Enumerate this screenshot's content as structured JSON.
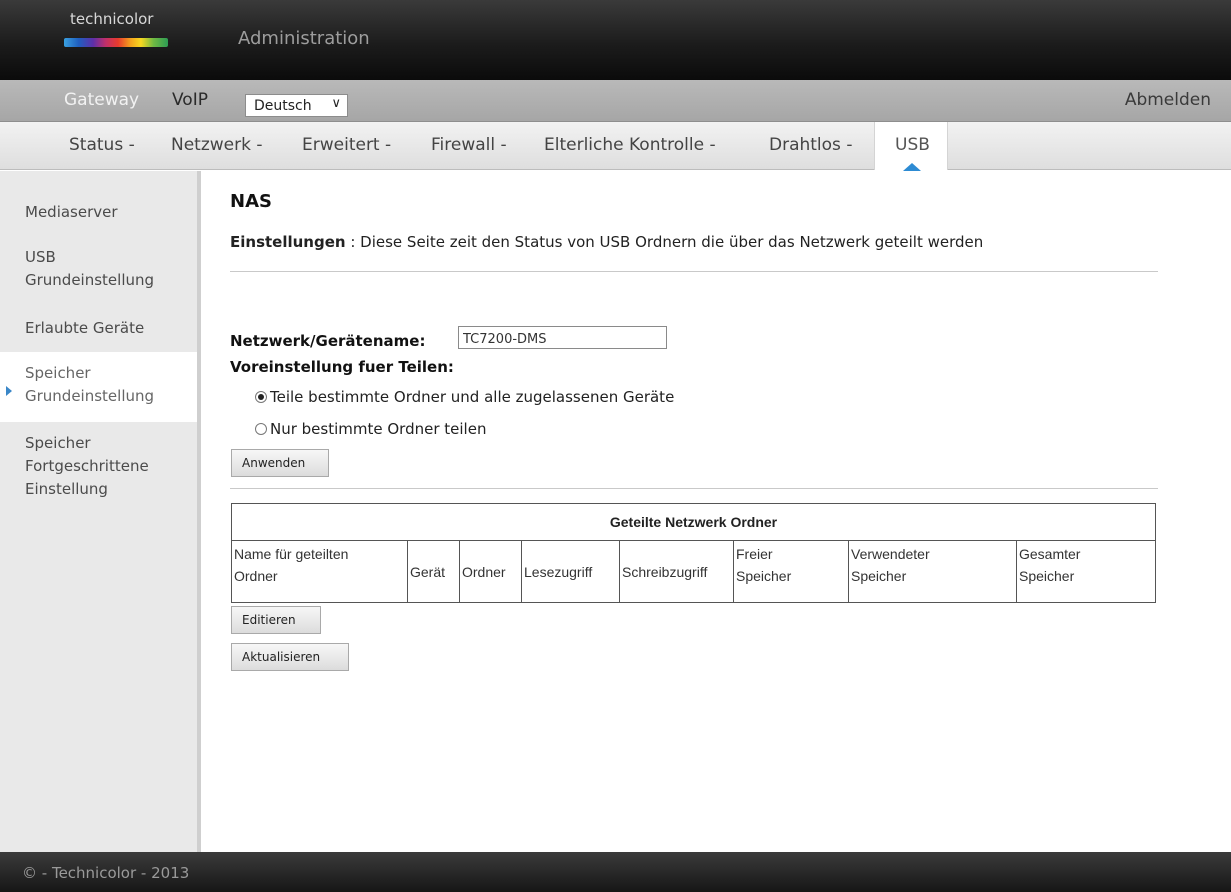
{
  "header": {
    "brand": "technicolor",
    "title": "Administration"
  },
  "nav_primary": {
    "gateway": "Gateway",
    "voip": "VoIP",
    "language_selected": "Deutsch",
    "logout": "Abmelden"
  },
  "nav_secondary": {
    "items": [
      "Status -",
      "Netzwerk -",
      "Erweitert -",
      "Firewall -",
      "Elterliche Kontrolle -",
      "Drahtlos -"
    ],
    "active": "USB"
  },
  "sidebar": {
    "items": [
      {
        "label": "Mediaserver"
      },
      {
        "label": "USB Grundeinstellung",
        "line1": "USB",
        "line2": "Grundeinstellung"
      },
      {
        "label": "Erlaubte Geräte"
      },
      {
        "label": "Speicher Grundeinstellung",
        "line1": "Speicher",
        "line2": "Grundeinstellung",
        "active": true
      },
      {
        "label": "Speicher Fortgeschrittene Einstellung",
        "line1": "Speicher",
        "line2": "Fortgeschrittene",
        "line3": "Einstellung"
      }
    ]
  },
  "main": {
    "heading": "NAS",
    "settings_label": "Einstellungen",
    "settings_text": " : Diese Seite zeit den Status von USB Ordnern die über das Netzwerk geteilt werden",
    "netname_label": "Netzwerk/Gerätename:",
    "netname_value": "TC7200-DMS",
    "share_default_label": "Voreinstellung fuer Teilen:",
    "radio_options": [
      {
        "label": "Teile bestimmte Ordner und alle zugelassenen Geräte",
        "checked": true
      },
      {
        "label": "Nur bestimmte Ordner teilen",
        "checked": false
      }
    ],
    "apply_button": "Anwenden",
    "table": {
      "caption": "Geteilte Netzwerk Ordner",
      "columns": [
        {
          "line1": "Name für geteilten",
          "line2": "Ordner"
        },
        {
          "line1": "Gerät"
        },
        {
          "line1": "Ordner"
        },
        {
          "line1": "Lesezugriff"
        },
        {
          "line1": "Schreibzugriff"
        },
        {
          "line1": "Freier",
          "line2": "Speicher"
        },
        {
          "line1": "Verwendeter",
          "line2": "Speicher"
        },
        {
          "line1": "Gesamter",
          "line2": "Speicher"
        }
      ]
    },
    "edit_button": "Editieren",
    "refresh_button": "Aktualisieren"
  },
  "footer": {
    "text": "© - Technicolor - 2013"
  }
}
